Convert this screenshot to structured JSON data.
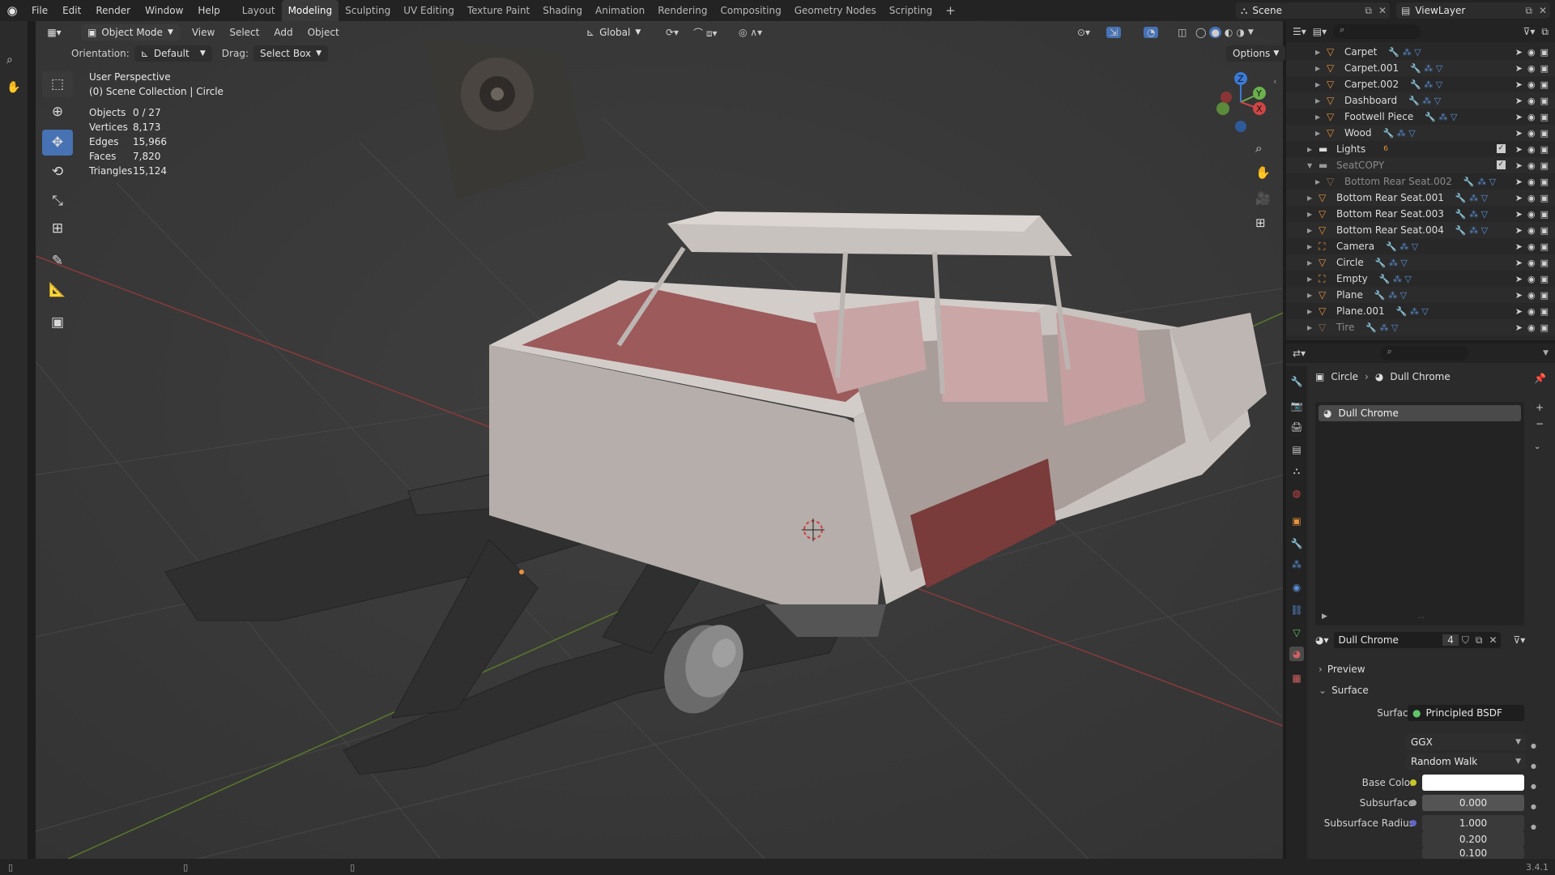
{
  "menu": [
    "File",
    "Edit",
    "Render",
    "Window",
    "Help"
  ],
  "workspaces": [
    "Layout",
    "Modeling",
    "Sculpting",
    "UV Editing",
    "Texture Paint",
    "Shading",
    "Animation",
    "Rendering",
    "Compositing",
    "Geometry Nodes",
    "Scripting"
  ],
  "active_workspace": "Modeling",
  "scene_name": "Scene",
  "view_layer": "ViewLayer",
  "viewport_header": {
    "mode": "Object Mode",
    "menus": [
      "View",
      "Select",
      "Add",
      "Object"
    ],
    "transform": "Global",
    "orientation_label": "Orientation:",
    "orientation_value": "Default",
    "drag_label": "Drag:",
    "drag_value": "Select Box",
    "options": "Options"
  },
  "overlay": {
    "perspective": "User Perspective",
    "collection": "(0) Scene Collection | Circle",
    "stats": [
      {
        "label": "Objects",
        "value": "0 / 27"
      },
      {
        "label": "Vertices",
        "value": "8,173"
      },
      {
        "label": "Edges",
        "value": "15,966"
      },
      {
        "label": "Faces",
        "value": "7,820"
      },
      {
        "label": "Triangles",
        "value": "15,124"
      }
    ]
  },
  "outliner": {
    "items": [
      {
        "name": "Carpet"
      },
      {
        "name": "Carpet.001"
      },
      {
        "name": "Carpet.002"
      },
      {
        "name": "Dashboard"
      },
      {
        "name": "Footwell Piece"
      },
      {
        "name": "Wood"
      },
      {
        "name": "Lights",
        "count": "6"
      },
      {
        "name": "SeatCOPY"
      },
      {
        "name": "Bottom Rear Seat.002"
      },
      {
        "name": "Bottom Rear Seat.001"
      },
      {
        "name": "Bottom Rear Seat.003"
      },
      {
        "name": "Bottom Rear Seat.004"
      },
      {
        "name": "Camera"
      },
      {
        "name": "Circle"
      },
      {
        "name": "Empty"
      },
      {
        "name": "Plane"
      },
      {
        "name": "Plane.001"
      },
      {
        "name": "Tire"
      }
    ]
  },
  "properties": {
    "breadcrumb_object": "Circle",
    "breadcrumb_material": "Dull Chrome",
    "slot_name": "Dull Chrome",
    "material_name": "Dull Chrome",
    "user_count": "4",
    "preview_label": "Preview",
    "surface_panel": "Surface",
    "surface_label": "Surface",
    "surface_value": "Principled BSDF",
    "distribution": "GGX",
    "subsurface_method": "Random Walk",
    "base_color_label": "Base Color",
    "subsurface_label": "Subsurface",
    "subsurface_value": "0.000",
    "subsurface_radius_label": "Subsurface Radius",
    "subsurface_radius": [
      "1.000",
      "0.200",
      "0.100"
    ]
  },
  "version": "3.4.1",
  "colors": {
    "accent": "#4772b3",
    "active_tab": "#3a3a3a",
    "object_orange": "#e8913b",
    "green_icon": "#5fc46a"
  }
}
